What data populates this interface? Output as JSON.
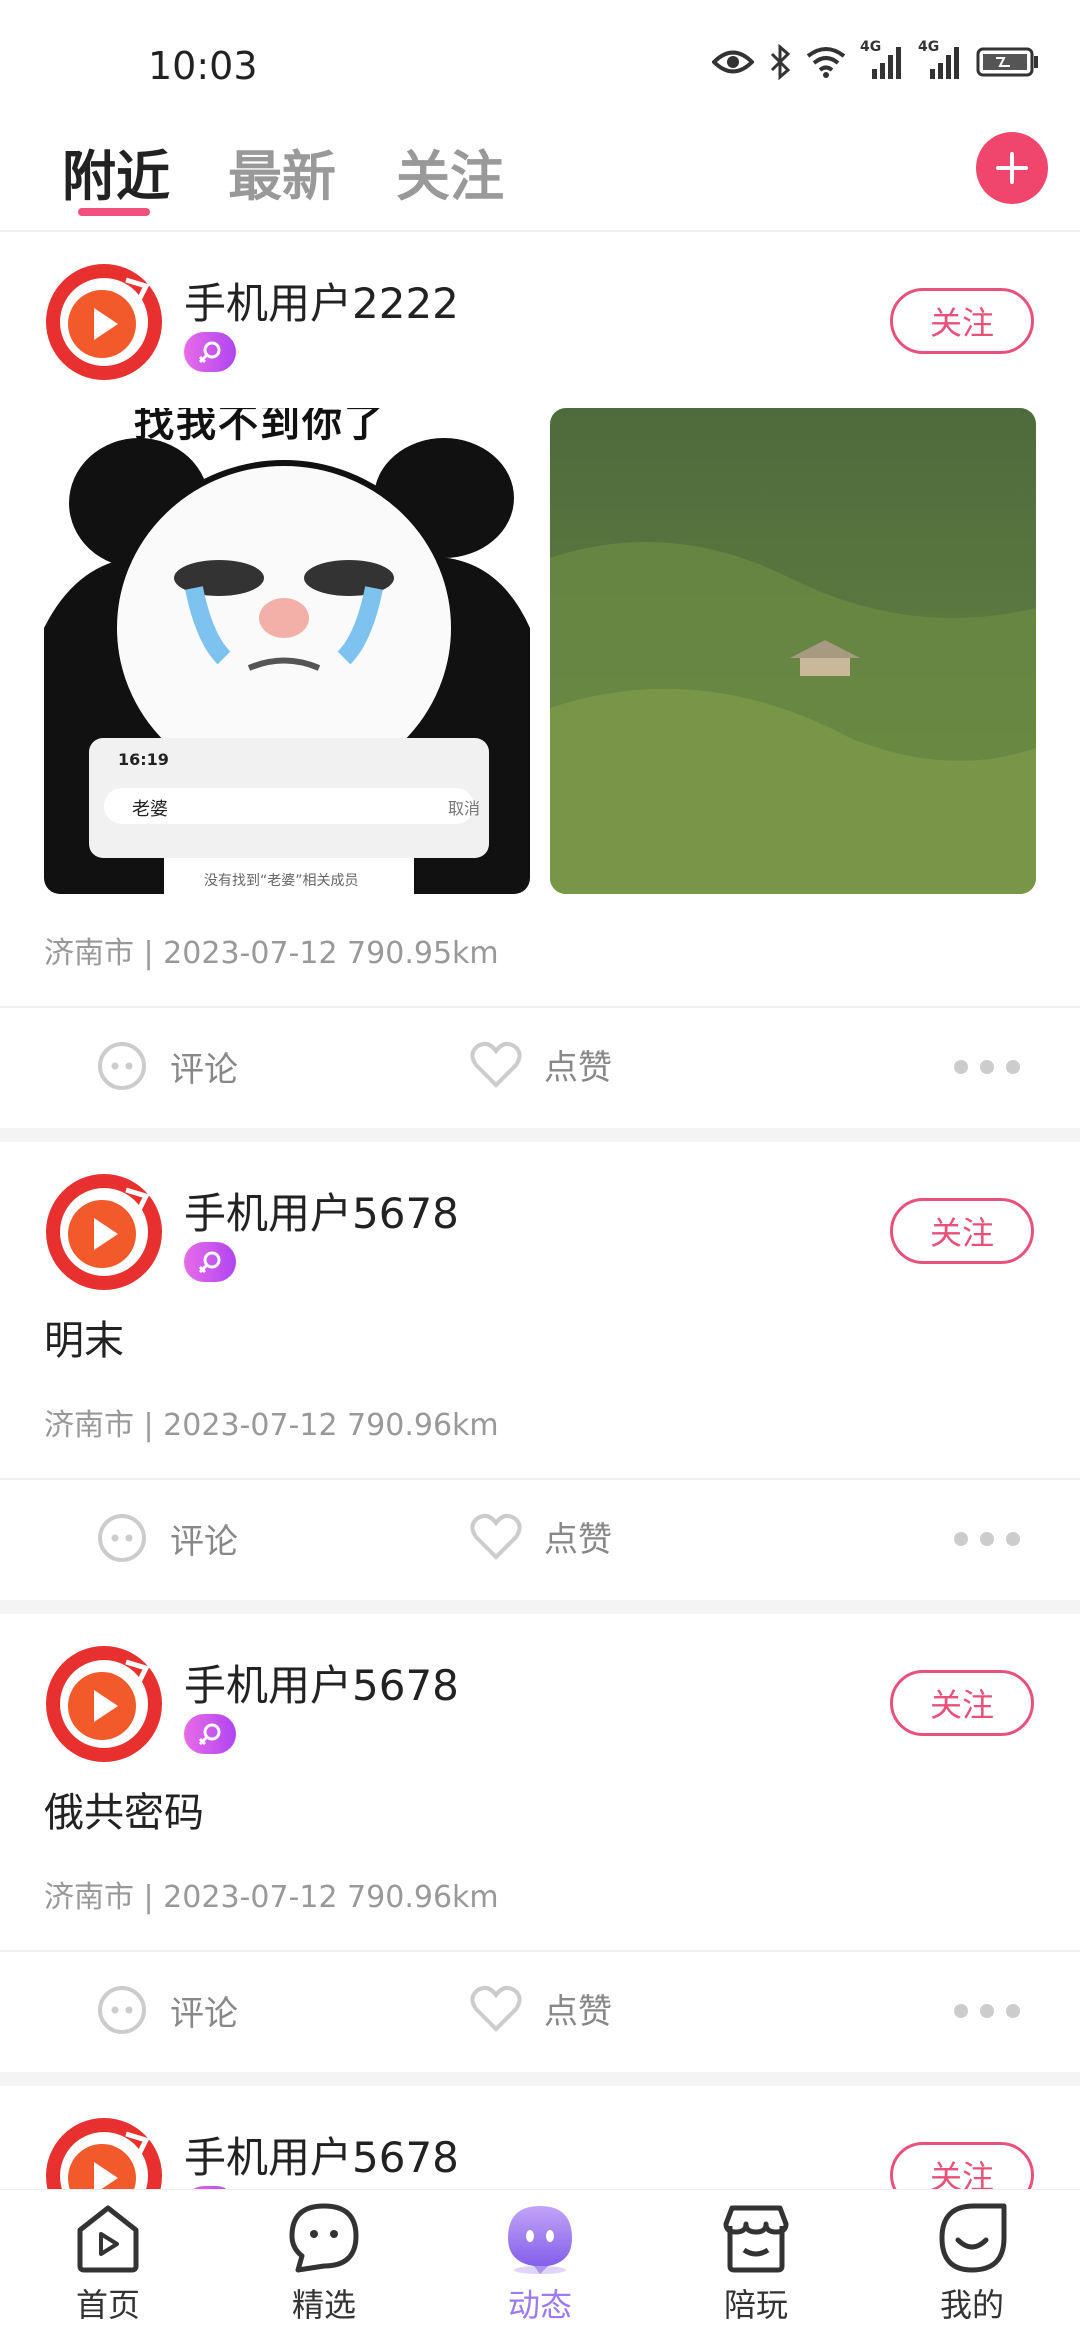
{
  "status_bar": {
    "time": "10:03",
    "network_badge_1": "4G",
    "network_badge_2": "4G"
  },
  "tabs": [
    {
      "label": "附近",
      "active": true
    },
    {
      "label": "最新",
      "active": false
    },
    {
      "label": "关注",
      "active": false
    }
  ],
  "posts": [
    {
      "username": "手机用户2222",
      "text": "",
      "has_images": true,
      "meme_caption": "找我不到你了",
      "meme_time": "16:19",
      "meme_search": "老婆",
      "meme_cancel": "取消",
      "meme_note": "没有找到“老婆”相关成员",
      "meta": "济南市 | 2023-07-12 790.95km",
      "follow_label": "关注",
      "comment_label": "评论",
      "like_label": "点赞"
    },
    {
      "username": "手机用户5678",
      "text": "明末",
      "has_images": false,
      "meta": "济南市 | 2023-07-12 790.96km",
      "follow_label": "关注",
      "comment_label": "评论",
      "like_label": "点赞"
    },
    {
      "username": "手机用户5678",
      "text": "俄共密码",
      "has_images": false,
      "meta": "济南市 | 2023-07-12 790.96km",
      "follow_label": "关注",
      "comment_label": "评论",
      "like_label": "点赞"
    },
    {
      "username": "手机用户5678",
      "follow_label": "关注"
    }
  ],
  "bottom_nav": [
    {
      "label": "首页",
      "icon": "home-play-icon"
    },
    {
      "label": "精选",
      "icon": "chat-face-icon"
    },
    {
      "label": "动态",
      "icon": "ghost-bubble-icon",
      "active": true
    },
    {
      "label": "陪玩",
      "icon": "shop-icon"
    },
    {
      "label": "我的",
      "icon": "smile-face-icon"
    }
  ],
  "colors": {
    "accent": "#f0466e",
    "follow_border": "#e8517a",
    "nav_active": "#9d7bf0",
    "badge": "#b044f0"
  }
}
